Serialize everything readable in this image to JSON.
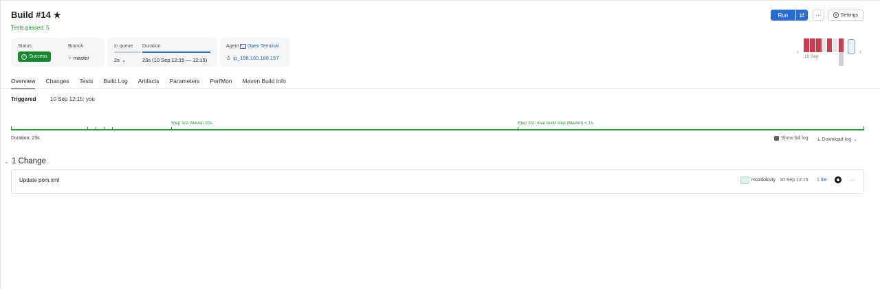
{
  "header": {
    "title": "Build #14",
    "star_icon": "star-icon",
    "tests_passed": "Tests passed: 5"
  },
  "actions": {
    "run_label": "Run",
    "more_label": "···",
    "settings_label": "Settings"
  },
  "cards": {
    "status": {
      "label": "Status",
      "value": "Success"
    },
    "branch": {
      "label": "Branch",
      "value": "master"
    },
    "queue": {
      "label": "In queue",
      "value": "2s",
      "chevron": "⌄"
    },
    "duration": {
      "label": "Duration",
      "value": "23s (10 Sep 12:15 — 12:15)"
    },
    "agent": {
      "label": "Agent",
      "open_terminal": "Open Terminal",
      "value": "ip_158.160.188.157"
    }
  },
  "history": {
    "date": "10 Sep",
    "prev": "‹",
    "next": "›"
  },
  "tabs": [
    "Overview",
    "Changes",
    "Tests",
    "Build Log",
    "Artifacts",
    "Parameters",
    "PerfMon",
    "Maven Build Info"
  ],
  "triggered": {
    "label": "Triggered",
    "value": "10 Sep 12:15: you"
  },
  "timeline": {
    "step1": "Step 1/2: Maven 10s",
    "step2": "Step 2/2: mvn build step (Maven) < 1s"
  },
  "log": {
    "duration": "Duration: 23s",
    "show_full_log": "Show full log",
    "download_log": "Download log",
    "download_chevron": "⌄"
  },
  "changes": {
    "chevron": "⌄",
    "title": "1 Change",
    "items": [
      {
        "message": "Update pom.xml",
        "user": "mozdoksity",
        "time": "10 Sep 12:15",
        "files": "1 file"
      }
    ],
    "more": "···"
  },
  "colors": {
    "accent": "#2b6bd6",
    "success": "#17862e",
    "failed": "#c93d4d"
  }
}
